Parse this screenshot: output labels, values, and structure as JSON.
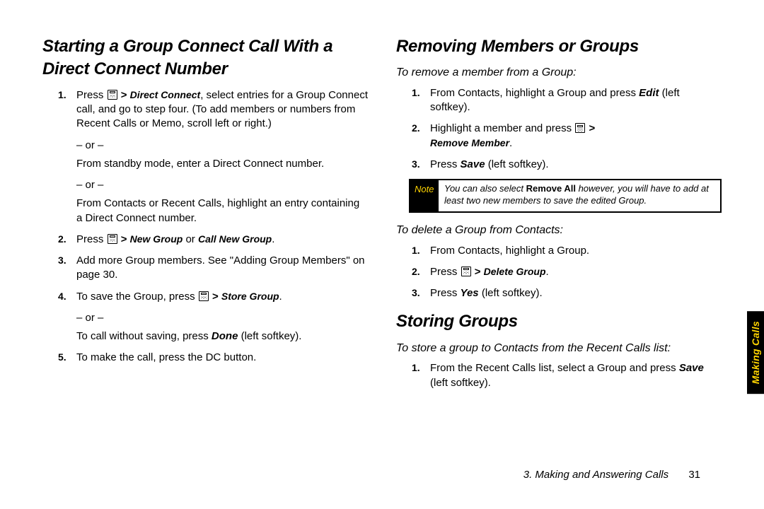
{
  "left": {
    "heading": "Starting a Group Connect Call With a Direct Connect Number",
    "s1a": "Press ",
    "s1b": ", select entries for a Group Connect call, and go to step four. (To add members or numbers from Recent Calls or Memo, scroll left or right.)",
    "s1_menu": "Direct Connect",
    "or": "– or –",
    "s1c": "From standby mode, enter a Direct Connect number.",
    "s1d": "From Contacts or Recent Calls, highlight an entry containing a Direct Connect number.",
    "s2a": "Press ",
    "s2_m1": "New Group",
    "s2_mid": " or ",
    "s2_m2": "Call New Group",
    "s3": "Add more Group members. See \"Adding Group Members\" on page 30.",
    "s4a": "To save the Group, press ",
    "s4_m": "Store Group",
    "s4b": "To call without saving, press ",
    "s4_done": "Done",
    "s4_sk": " (left softkey).",
    "s5": "To make the call, press the DC button."
  },
  "right": {
    "h_remove": "Removing Members or Groups",
    "sub_remove_member": "To remove a member from a Group:",
    "rm1a": "From Contacts, highlight a Group and press ",
    "rm1_edit": "Edit",
    "rm1b": " (left softkey).",
    "rm2a": "Highlight a member and press ",
    "rm2_m": "Remove Member",
    "rm3a": "Press ",
    "rm3_save": "Save",
    "rm3b": " (left softkey).",
    "note_label": "Note",
    "note_a": "You can also select ",
    "note_ra": "Remove All",
    "note_b": " however, you will have to add at least two new members to save the edited Group.",
    "sub_delete_group": "To delete a Group from Contacts:",
    "dg1": "From Contacts, highlight a Group.",
    "dg2a": "Press ",
    "dg2_m": "Delete Group",
    "dg3a": "Press ",
    "dg3_yes": "Yes",
    "dg3b": " (left softkey).",
    "h_store": "Storing Groups",
    "sub_store": "To store a group to Contacts from the Recent Calls list:",
    "st1a": "From the Recent Calls list, select a Group and press ",
    "st1_save": "Save",
    "st1b": " (left softkey)."
  },
  "sidebar": "Making Calls",
  "footer_section": "3. Making and Answering Calls",
  "footer_page": "31"
}
